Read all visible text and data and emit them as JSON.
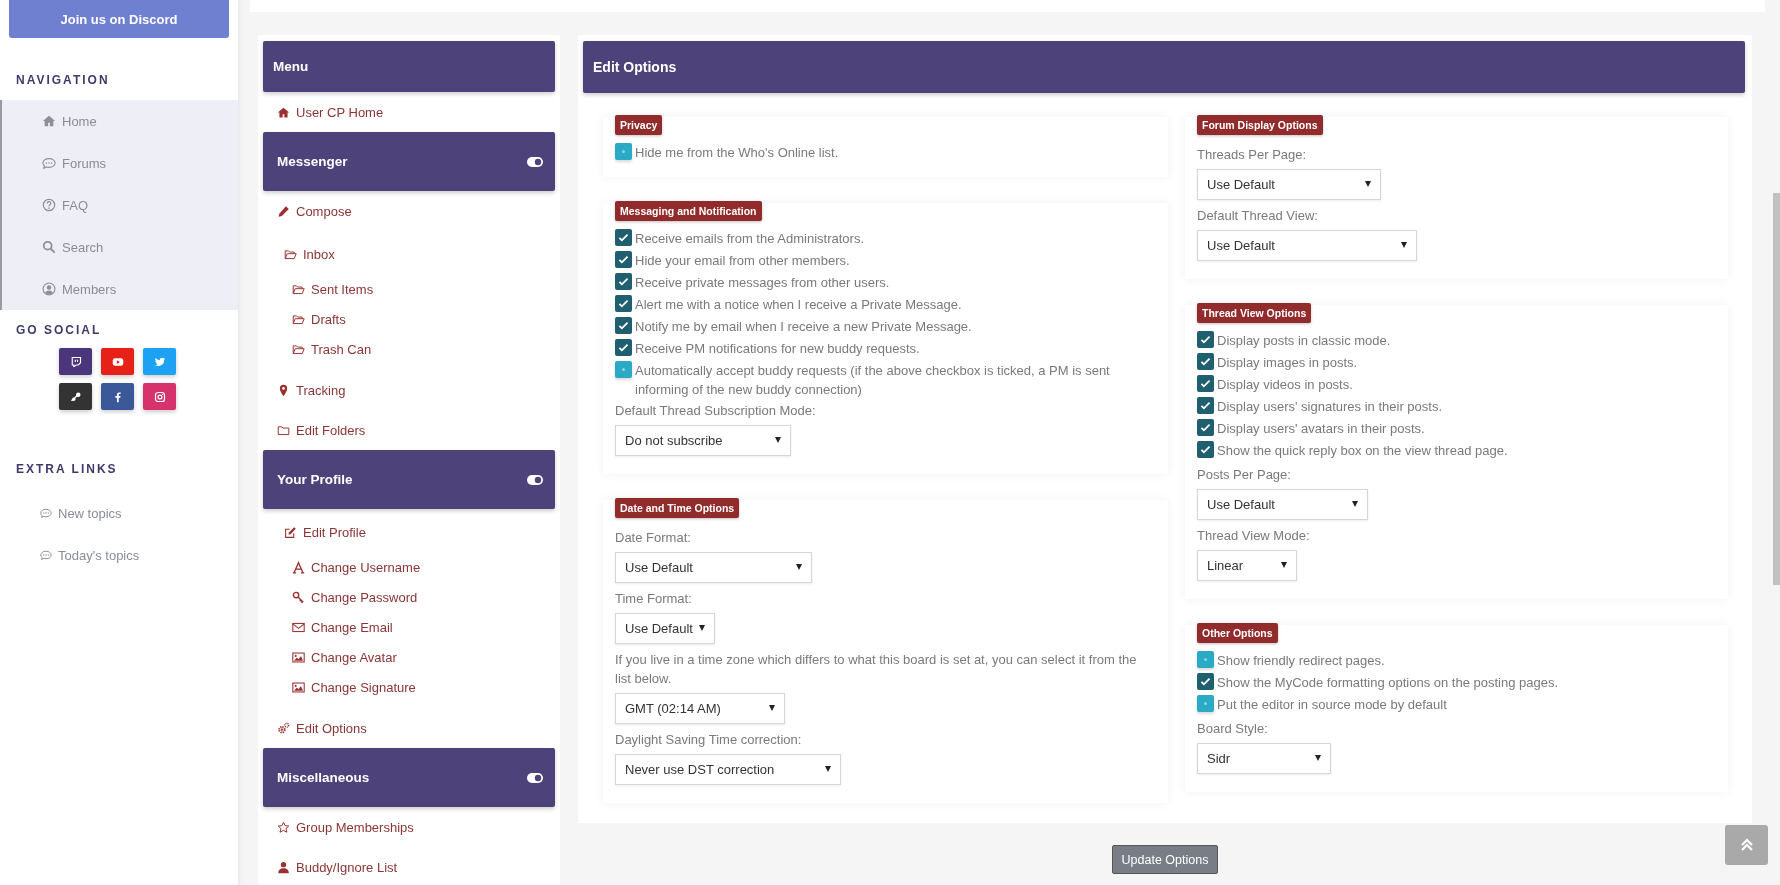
{
  "sidebar": {
    "discord_button": "Join us on Discord",
    "navigation": {
      "title": "NAVIGATION",
      "items": [
        {
          "label": "Home"
        },
        {
          "label": "Forums"
        },
        {
          "label": "FAQ"
        },
        {
          "label": "Search"
        },
        {
          "label": "Members"
        }
      ]
    },
    "social": {
      "title": "GO SOCIAL",
      "links": [
        {
          "color": "#4b367c"
        },
        {
          "color": "#e62117"
        },
        {
          "color": "#1da1f2"
        },
        {
          "color": "#333333"
        },
        {
          "color": "#3b5998"
        },
        {
          "color": "#d6336c"
        }
      ]
    },
    "extra_links": {
      "title": "EXTRA LINKS",
      "items": [
        {
          "label": "New topics"
        },
        {
          "label": "Today's topics"
        }
      ]
    }
  },
  "menu": [
    {
      "title": "Menu",
      "collapsible": false,
      "items": [
        {
          "label": "User CP Home"
        }
      ]
    },
    {
      "title": "Messenger",
      "collapsible": true,
      "items": [
        {
          "label": "Compose"
        },
        {
          "label": "Inbox",
          "children": [
            {
              "label": "Sent Items"
            },
            {
              "label": "Drafts"
            },
            {
              "label": "Trash Can"
            }
          ]
        },
        {
          "label": "Tracking"
        },
        {
          "label": "Edit Folders"
        }
      ]
    },
    {
      "title": "Your Profile",
      "collapsible": true,
      "items": [
        {
          "label": "Edit Profile",
          "children": [
            {
              "label": "Change Username"
            },
            {
              "label": "Change Password"
            },
            {
              "label": "Change Email"
            },
            {
              "label": "Change Avatar"
            },
            {
              "label": "Change Signature"
            }
          ]
        },
        {
          "label": "Edit Options"
        }
      ]
    },
    {
      "title": "Miscellaneous",
      "collapsible": true,
      "items": [
        {
          "label": "Group Memberships"
        },
        {
          "label": "Buddy/Ignore List"
        }
      ]
    }
  ],
  "panel": {
    "title": "Edit Options",
    "columns": [
      [
        {
          "title": "Privacy",
          "fields": [
            {
              "kind": "checkbox",
              "label": "Hide me from the Who's Online list.",
              "checked": false
            }
          ]
        },
        {
          "title": "Messaging and Notification",
          "fields": [
            {
              "kind": "checkbox",
              "label": "Receive emails from the Administrators.",
              "checked": true
            },
            {
              "kind": "checkbox",
              "label": "Hide your email from other members.",
              "checked": true
            },
            {
              "kind": "checkbox",
              "label": "Receive private messages from other users.",
              "checked": true
            },
            {
              "kind": "checkbox",
              "label": "Alert me with a notice when I receive a Private Message.",
              "checked": true
            },
            {
              "kind": "checkbox",
              "label": "Notify me by email when I receive a new Private Message.",
              "checked": true
            },
            {
              "kind": "checkbox",
              "label": "Receive PM notifications for new buddy requests.",
              "checked": true
            },
            {
              "kind": "checkbox",
              "label": "Automatically accept buddy requests (if the above checkbox is ticked, a PM is sent informing of the new buddy connection)",
              "checked": false
            },
            {
              "kind": "select",
              "label": "Default Thread Subscription Mode:",
              "value": "Do not subscribe"
            }
          ]
        },
        {
          "title": "Date and Time Options",
          "fields": [
            {
              "kind": "select",
              "label": "Date Format:",
              "value": "Use Default"
            },
            {
              "kind": "select",
              "label": "Time Format:",
              "value": "Use Default"
            },
            {
              "kind": "select",
              "label": "If you live in a time zone which differs to what this board is set at, you can select it from the list below.",
              "value": "GMT (02:14 AM)"
            },
            {
              "kind": "select",
              "label": "Daylight Saving Time correction:",
              "value": "Never use DST correction"
            }
          ]
        }
      ],
      [
        {
          "title": "Forum Display Options",
          "fields": [
            {
              "kind": "select",
              "label": "Threads Per Page:",
              "value": "Use Default"
            },
            {
              "kind": "select",
              "label": "Default Thread View:",
              "value": "Use Default"
            }
          ]
        },
        {
          "title": "Thread View Options",
          "fields": [
            {
              "kind": "checkbox",
              "label": "Display posts in classic mode.",
              "checked": true
            },
            {
              "kind": "checkbox",
              "label": "Display images in posts.",
              "checked": true
            },
            {
              "kind": "checkbox",
              "label": "Display videos in posts.",
              "checked": true
            },
            {
              "kind": "checkbox",
              "label": "Display users' signatures in their posts.",
              "checked": true
            },
            {
              "kind": "checkbox",
              "label": "Display users' avatars in their posts.",
              "checked": true
            },
            {
              "kind": "checkbox",
              "label": "Show the quick reply box on the view thread page.",
              "checked": true
            },
            {
              "kind": "select",
              "label": "Posts Per Page:",
              "value": "Use Default"
            },
            {
              "kind": "select",
              "label": "Thread View Mode:",
              "value": "Linear"
            }
          ]
        },
        {
          "title": "Other Options",
          "fields": [
            {
              "kind": "checkbox",
              "label": "Show friendly redirect pages.",
              "checked": false
            },
            {
              "kind": "checkbox",
              "label": "Show the MyCode formatting options on the posting pages.",
              "checked": true
            },
            {
              "kind": "checkbox",
              "label": "Put the editor in source mode by default",
              "checked": false
            },
            {
              "kind": "select",
              "label": "Board Style:",
              "value": "Sidr"
            }
          ]
        }
      ]
    ]
  },
  "update_button": "Update Options"
}
